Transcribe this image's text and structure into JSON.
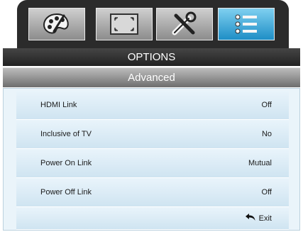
{
  "tabs": [
    {
      "icon": "palette-icon",
      "active": false
    },
    {
      "icon": "screen-frame-icon",
      "active": false
    },
    {
      "icon": "tools-icon",
      "active": false
    },
    {
      "icon": "options-list-icon",
      "active": true
    }
  ],
  "header": {
    "title": "OPTIONS",
    "subtitle": "Advanced"
  },
  "rows": [
    {
      "label": "HDMI Link",
      "value": "Off"
    },
    {
      "label": "Inclusive of TV",
      "value": "No"
    },
    {
      "label": "Power On Link",
      "value": "Mutual"
    },
    {
      "label": "Power Off Link",
      "value": "Off"
    }
  ],
  "footer": {
    "exit_label": "Exit",
    "exit_icon": "return-arrow-icon"
  }
}
